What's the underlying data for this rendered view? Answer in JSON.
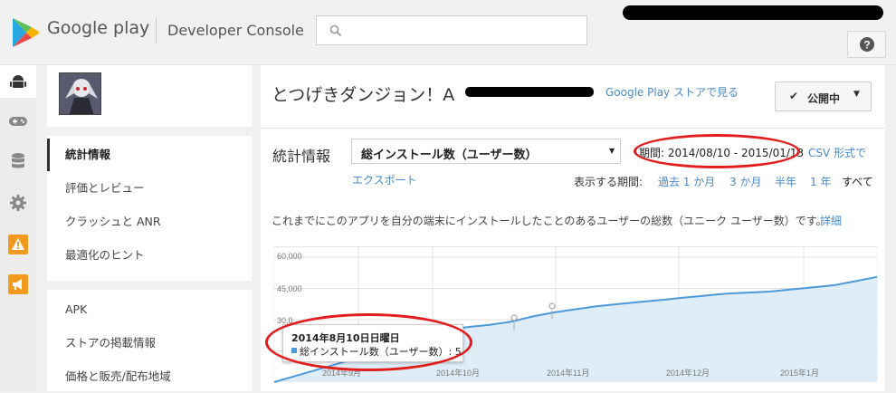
{
  "header": {
    "brand": "Google play",
    "console": "Developer Console",
    "help_icon": "help-icon"
  },
  "rail": {
    "icons": [
      "android-icon",
      "gamepad-icon",
      "database-icon",
      "gear-icon",
      "warning-icon",
      "megaphone-icon"
    ]
  },
  "nav": {
    "items": [
      "統計情報",
      "評価とレビュー",
      "クラッシュと ANR",
      "最適化のヒント"
    ],
    "items2": [
      "APK",
      "ストアの掲載情報",
      "価格と販売/配布地域"
    ]
  },
  "app": {
    "title": "とつげきダンジョン！A",
    "store_link": "Google Play ストアで見る",
    "publish_label": "公開中"
  },
  "stats": {
    "label": "統計情報",
    "metric": "総インストール数（ユーザー数）",
    "period": "期間: 2014/08/10 - 2015/01/13",
    "export_1": "CSV 形式で",
    "export_2": "エクスポート",
    "period_label": "表示する期間:",
    "ranges": [
      "過去 1 か月",
      "3 か月",
      "半年",
      "1 年",
      "すべて"
    ],
    "description": "これまでにこのアプリを自分の端末にインストールしたことのあるユーザーの総数（ユニーク ユーザー数）です。",
    "details": "詳細"
  },
  "chart_data": {
    "type": "area",
    "y_ticks": [
      "60,000",
      "45,000",
      "30,0"
    ],
    "x_ticks": [
      "2014年9月",
      "2014年10月",
      "2014年11月",
      "2014年12月",
      "2015年1月"
    ],
    "ylim": [
      0,
      60000
    ],
    "series": [
      {
        "values": [
          5,
          3000,
          6000,
          9000,
          12000,
          15000,
          18500,
          22000,
          25000,
          26500,
          27500,
          29000,
          31500,
          33500,
          35000,
          36500,
          37500,
          38500,
          39500,
          40500,
          41500,
          42500,
          43000,
          43500,
          44500,
          45500,
          46500,
          48500,
          50500
        ]
      }
    ],
    "color": "#4c9ad8",
    "fill": "#deedf7"
  },
  "tooltip": {
    "date": "2014年8月10日日曜日",
    "series": "総インストール数（ユーザー数）: 5"
  }
}
